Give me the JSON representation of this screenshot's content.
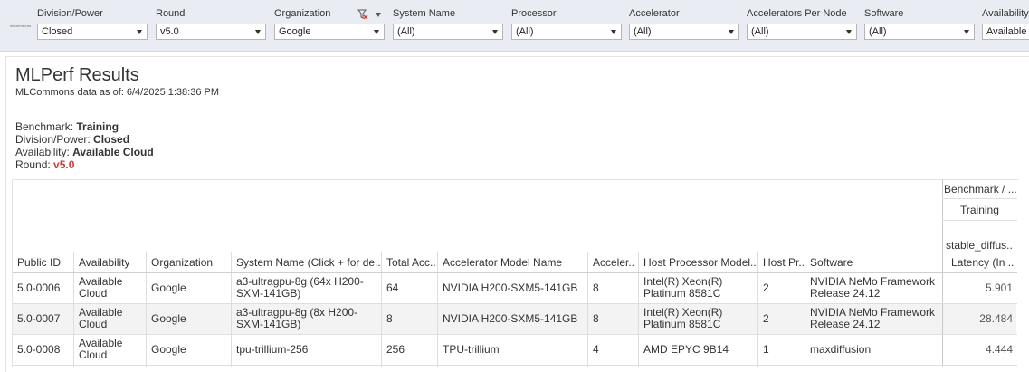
{
  "logo_text": "mlcommons",
  "filters": [
    {
      "label": "Division/Power",
      "value": "Closed"
    },
    {
      "label": "Round",
      "value": "v5.0"
    },
    {
      "label": "Organization",
      "value": "Google"
    },
    {
      "label": "System Name",
      "value": "(All)"
    },
    {
      "label": "Processor",
      "value": "(All)"
    },
    {
      "label": "Accelerator",
      "value": "(All)"
    },
    {
      "label": "Accelerators Per Node",
      "value": "(All)"
    },
    {
      "label": "Software",
      "value": "(All)"
    },
    {
      "label": "Availability",
      "value": "Available"
    }
  ],
  "page": {
    "title": "MLPerf Results",
    "subtitle": "MLCommons data as of: 6/4/2025 1:38:36 PM"
  },
  "info": {
    "benchmark_label": "Benchmark: ",
    "benchmark_value": "Training",
    "division_label": "Division/Power: ",
    "division_value": "Closed",
    "availability_label": "Availability: ",
    "availability_value": "Available Cloud",
    "round_label": "Round: ",
    "round_value": "v5.0"
  },
  "table": {
    "group_headers": {
      "level1": "Benchmark / ...",
      "level2": "Training",
      "level3": "stable_diffus.."
    },
    "columns": [
      "Public ID",
      "Availability",
      "Organization",
      "System Name (Click + for de..",
      "Total Acc..",
      "Accelerator Model Name",
      "Acceler..",
      "Host Processor Model..",
      "Host Pr..",
      "Software",
      "Latency (In .."
    ],
    "rows": [
      {
        "public_id": "5.0-0006",
        "availability": "Available Cloud",
        "organization": "Google",
        "system_name": "a3-ultragpu-8g (64x H200-SXM-141GB)",
        "total_accelerators": "64",
        "accelerator_model": "NVIDIA H200-SXM5-141GB",
        "accelerators_per_node": "8",
        "host_processor": "Intel(R) Xeon(R) Platinum 8581C",
        "host_processors_per_node": "2",
        "software": "NVIDIA NeMo Framework Release 24.12",
        "latency": "5.901"
      },
      {
        "public_id": "5.0-0007",
        "availability": "Available Cloud",
        "organization": "Google",
        "system_name": "a3-ultragpu-8g (8x H200-SXM-141GB)",
        "total_accelerators": "8",
        "accelerator_model": "NVIDIA H200-SXM5-141GB",
        "accelerators_per_node": "8",
        "host_processor": "Intel(R) Xeon(R) Platinum 8581C",
        "host_processors_per_node": "2",
        "software": "NVIDIA NeMo Framework Release 24.12",
        "latency": "28.484"
      },
      {
        "public_id": "5.0-0008",
        "availability": "Available Cloud",
        "organization": "Google",
        "system_name": "tpu-trillium-256",
        "total_accelerators": "256",
        "accelerator_model": "TPU-trillium",
        "accelerators_per_node": "4",
        "host_processor": "AMD EPYC 9B14",
        "host_processors_per_node": "1",
        "software": "maxdiffusion",
        "latency": "4.444"
      }
    ]
  }
}
